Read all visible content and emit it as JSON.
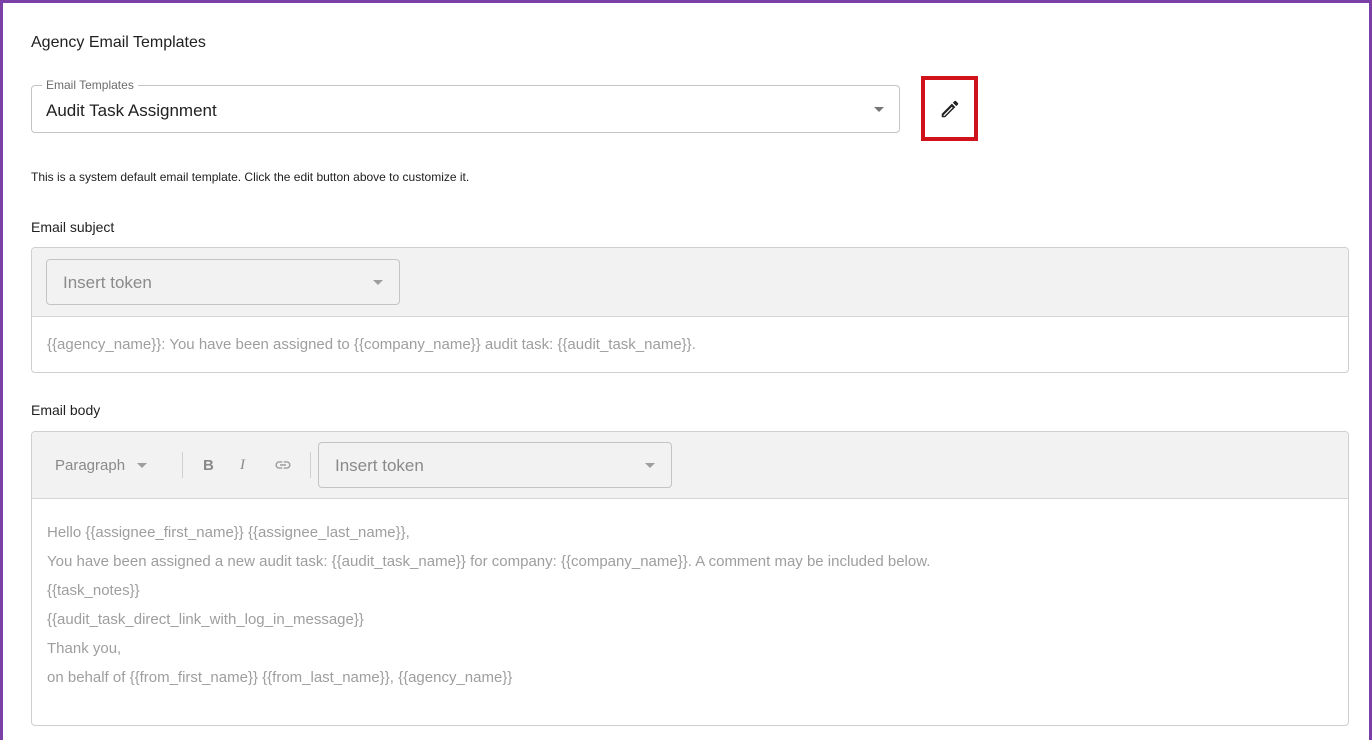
{
  "page": {
    "title": "Agency Email Templates"
  },
  "template_select": {
    "legend": "Email Templates",
    "value": "Audit Task Assignment"
  },
  "edit_button": {
    "icon": "pencil-icon",
    "highlight_color": "#d0121b"
  },
  "info_text": "This is a system default email template. Click the edit button above to customize it.",
  "subject": {
    "label": "Email subject",
    "token_placeholder": "Insert token",
    "text": "{{agency_name}}: You have been assigned to {{company_name}} audit task: {{audit_task_name}}."
  },
  "body": {
    "label": "Email body",
    "toolbar": {
      "block_format": "Paragraph",
      "bold_label": "B",
      "italic_label": "I",
      "link_icon": "link-icon",
      "token_placeholder": "Insert token"
    },
    "lines": [
      "Hello {{assignee_first_name}} {{assignee_last_name}},",
      "You have been assigned a new audit task: {{audit_task_name}} for company: {{company_name}}. A comment may be included below.",
      "{{task_notes}}",
      "{{audit_task_direct_link_with_log_in_message}}",
      "Thank you,",
      "on behalf of {{from_first_name}} {{from_last_name}}, {{agency_name}}"
    ]
  },
  "colors": {
    "frame_border": "#7b3fa8",
    "toolbar_bg": "#f2f2f2",
    "muted_text": "#9e9e9e"
  }
}
